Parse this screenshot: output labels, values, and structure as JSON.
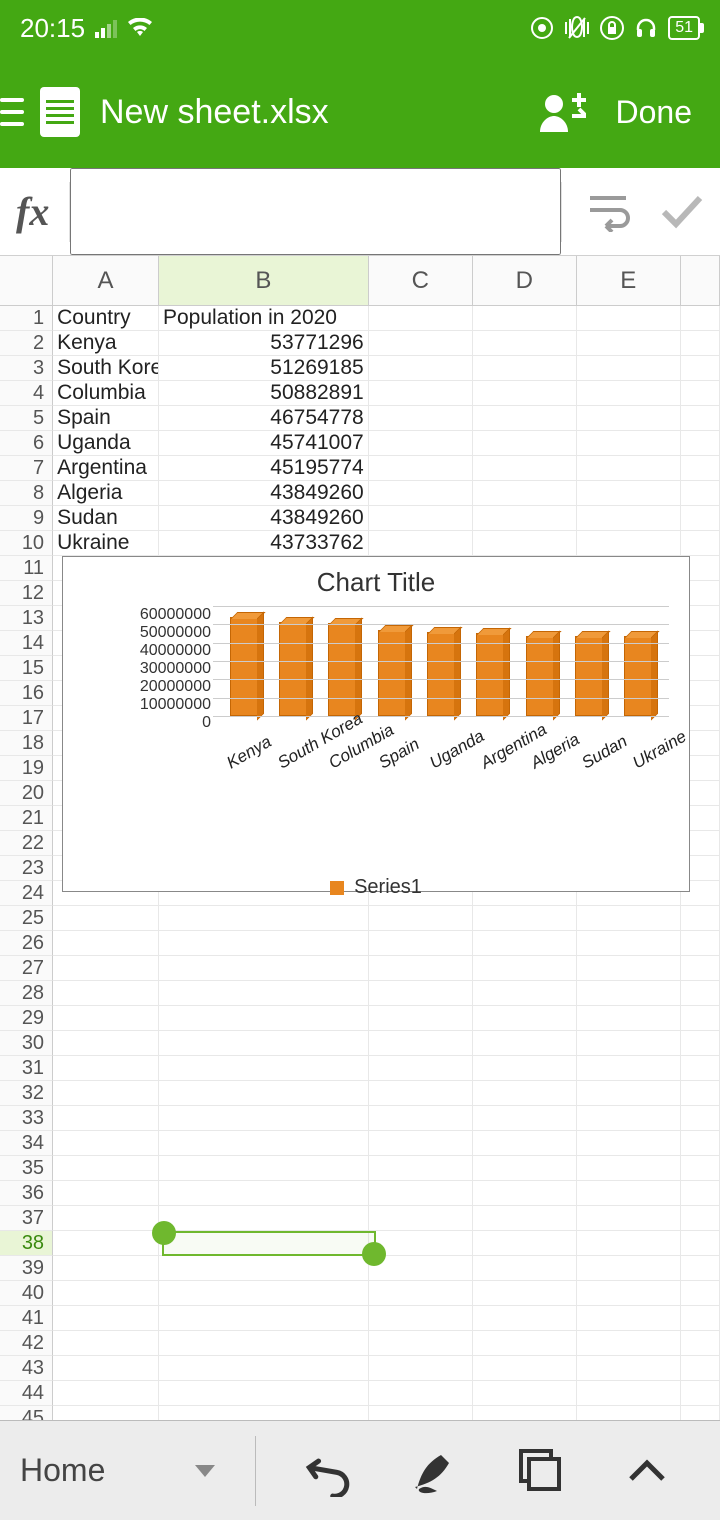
{
  "statusbar": {
    "time": "20:15",
    "battery": "51"
  },
  "header": {
    "title": "New sheet.xlsx",
    "done_label": "Done"
  },
  "fxbar": {
    "placeholder": ""
  },
  "columns": [
    "A",
    "B",
    "C",
    "D",
    "E"
  ],
  "selected_column_index": 1,
  "row_count": 46,
  "selected_row": 38,
  "cells": {
    "r1cA": "Country",
    "r1cB": "Population in 2020",
    "r2cA": "Kenya",
    "r2cB": "53771296",
    "r3cA": "South Korea",
    "r3cB": "51269185",
    "r4cA": "Columbia",
    "r4cB": "50882891",
    "r5cA": "Spain",
    "r5cB": "46754778",
    "r6cA": "Uganda",
    "r6cB": "45741007",
    "r7cA": "Argentina",
    "r7cB": "45195774",
    "r8cA": "Algeria",
    "r8cB": "43849260",
    "r9cA": "Sudan",
    "r9cB": "43849260",
    "r10cA": "Ukraine",
    "r10cB": "43733762"
  },
  "chart_data": {
    "type": "bar",
    "title": "Chart Title",
    "categories": [
      "Kenya",
      "South Korea",
      "Columbia",
      "Spain",
      "Uganda",
      "Argentina",
      "Algeria",
      "Sudan",
      "Ukraine"
    ],
    "series": [
      {
        "name": "Series1",
        "values": [
          53771296,
          51269185,
          50882891,
          46754778,
          45741007,
          45195774,
          43849260,
          43849260,
          43733762
        ]
      }
    ],
    "y_ticks": [
      60000000,
      50000000,
      40000000,
      30000000,
      20000000,
      10000000,
      0
    ],
    "ylim": [
      0,
      60000000
    ],
    "legend_label": "Series1"
  },
  "toolbar": {
    "home_label": "Home"
  }
}
